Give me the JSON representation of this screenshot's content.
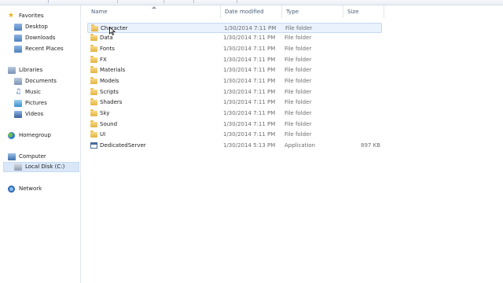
{
  "nav": {
    "favorites": "Favorites",
    "favorites_items": [
      "Desktop",
      "Downloads",
      "Recent Places"
    ],
    "libraries": "Libraries",
    "libraries_items": [
      "Documents",
      "Music",
      "Pictures",
      "Videos"
    ],
    "homegroup": "Homegroup",
    "computer": "Computer",
    "computer_items": [
      "Local Disk (C:)"
    ],
    "network": "Network"
  },
  "columns": {
    "name": "Name",
    "date": "Date modified",
    "type": "Type",
    "size": "Size"
  },
  "rows": [
    {
      "name": "Character",
      "date": "1/30/2014 7:11 PM",
      "type": "File folder",
      "size": "",
      "icon": "folder-icon"
    },
    {
      "name": "Data",
      "date": "1/30/2014 7:11 PM",
      "type": "File folder",
      "size": "",
      "icon": "folder-icon"
    },
    {
      "name": "Fonts",
      "date": "1/30/2014 7:11 PM",
      "type": "File folder",
      "size": "",
      "icon": "folder-icon"
    },
    {
      "name": "FX",
      "date": "1/30/2014 7:11 PM",
      "type": "File folder",
      "size": "",
      "icon": "folder-icon"
    },
    {
      "name": "Materials",
      "date": "1/30/2014 7:11 PM",
      "type": "File folder",
      "size": "",
      "icon": "folder-icon"
    },
    {
      "name": "Models",
      "date": "1/30/2014 7:11 PM",
      "type": "File folder",
      "size": "",
      "icon": "folder-icon"
    },
    {
      "name": "Scripts",
      "date": "1/30/2014 7:11 PM",
      "type": "File folder",
      "size": "",
      "icon": "folder-icon"
    },
    {
      "name": "Shaders",
      "date": "1/30/2014 7:11 PM",
      "type": "File folder",
      "size": "",
      "icon": "folder-icon"
    },
    {
      "name": "Sky",
      "date": "1/30/2014 7:11 PM",
      "type": "File folder",
      "size": "",
      "icon": "folder-icon"
    },
    {
      "name": "Sound",
      "date": "1/30/2014 7:11 PM",
      "type": "File folder",
      "size": "",
      "icon": "folder-icon"
    },
    {
      "name": "UI",
      "date": "1/30/2014 7:11 PM",
      "type": "File folder",
      "size": "",
      "icon": "folder-icon"
    },
    {
      "name": "DedicatedServer",
      "date": "1/30/2014 5:13 PM",
      "type": "Application",
      "size": "897 KB",
      "icon": "application-icon"
    }
  ],
  "colors": {
    "hover_row": "#eaf2fd",
    "selected_nav": "#d9e7f8",
    "header_text": "#4c607a"
  }
}
